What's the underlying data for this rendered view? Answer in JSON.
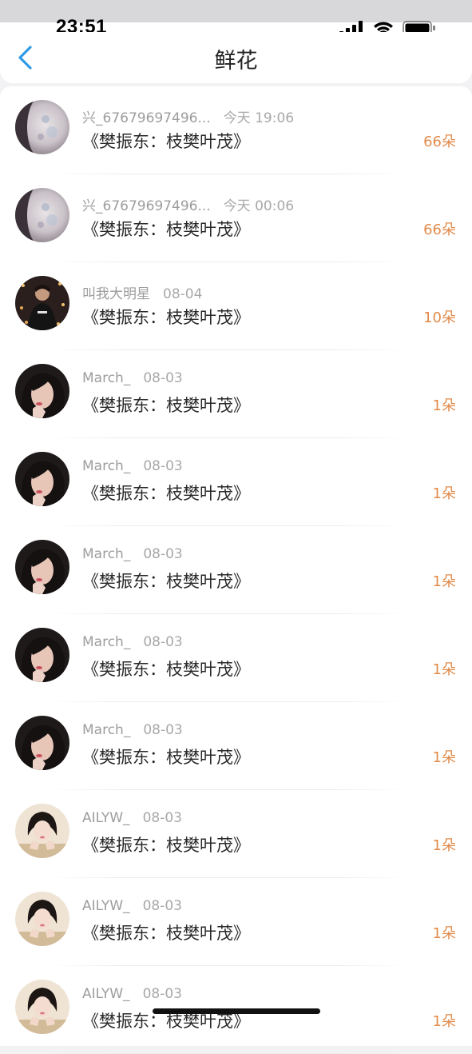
{
  "status_bar": {
    "time": "23:51"
  },
  "nav": {
    "title": "鲜花"
  },
  "colors": {
    "accent": "#2f9ae6",
    "amount": "#e28a4a"
  },
  "items": [
    {
      "user": "兴_67679697496...",
      "date": "今天 19:06",
      "title": "《樊振东：枝樊叶茂》",
      "amount": "66朵",
      "avatar": "moon"
    },
    {
      "user": "兴_67679697496...",
      "date": "今天 00:06",
      "title": "《樊振东：枝樊叶茂》",
      "amount": "66朵",
      "avatar": "moon"
    },
    {
      "user": "叫我大明星",
      "date": "08-04",
      "title": "《樊振东：枝樊叶茂》",
      "amount": "10朵",
      "avatar": "star"
    },
    {
      "user": "March_",
      "date": "08-03",
      "title": "《樊振东：枝樊叶茂》",
      "amount": "1朵",
      "avatar": "girl-dark"
    },
    {
      "user": "March_",
      "date": "08-03",
      "title": "《樊振东：枝樊叶茂》",
      "amount": "1朵",
      "avatar": "girl-dark"
    },
    {
      "user": "March_",
      "date": "08-03",
      "title": "《樊振东：枝樊叶茂》",
      "amount": "1朵",
      "avatar": "girl-dark"
    },
    {
      "user": "March_",
      "date": "08-03",
      "title": "《樊振东：枝樊叶茂》",
      "amount": "1朵",
      "avatar": "girl-dark"
    },
    {
      "user": "March_",
      "date": "08-03",
      "title": "《樊振东：枝樊叶茂》",
      "amount": "1朵",
      "avatar": "girl-dark"
    },
    {
      "user": "AILYW_",
      "date": "08-03",
      "title": "《樊振东：枝樊叶茂》",
      "amount": "1朵",
      "avatar": "girl-light"
    },
    {
      "user": "AILYW_",
      "date": "08-03",
      "title": "《樊振东：枝樊叶茂》",
      "amount": "1朵",
      "avatar": "girl-light"
    },
    {
      "user": "AILYW_",
      "date": "08-03",
      "title": "《樊振东：枝樊叶茂》",
      "amount": "1朵",
      "avatar": "girl-light"
    }
  ]
}
